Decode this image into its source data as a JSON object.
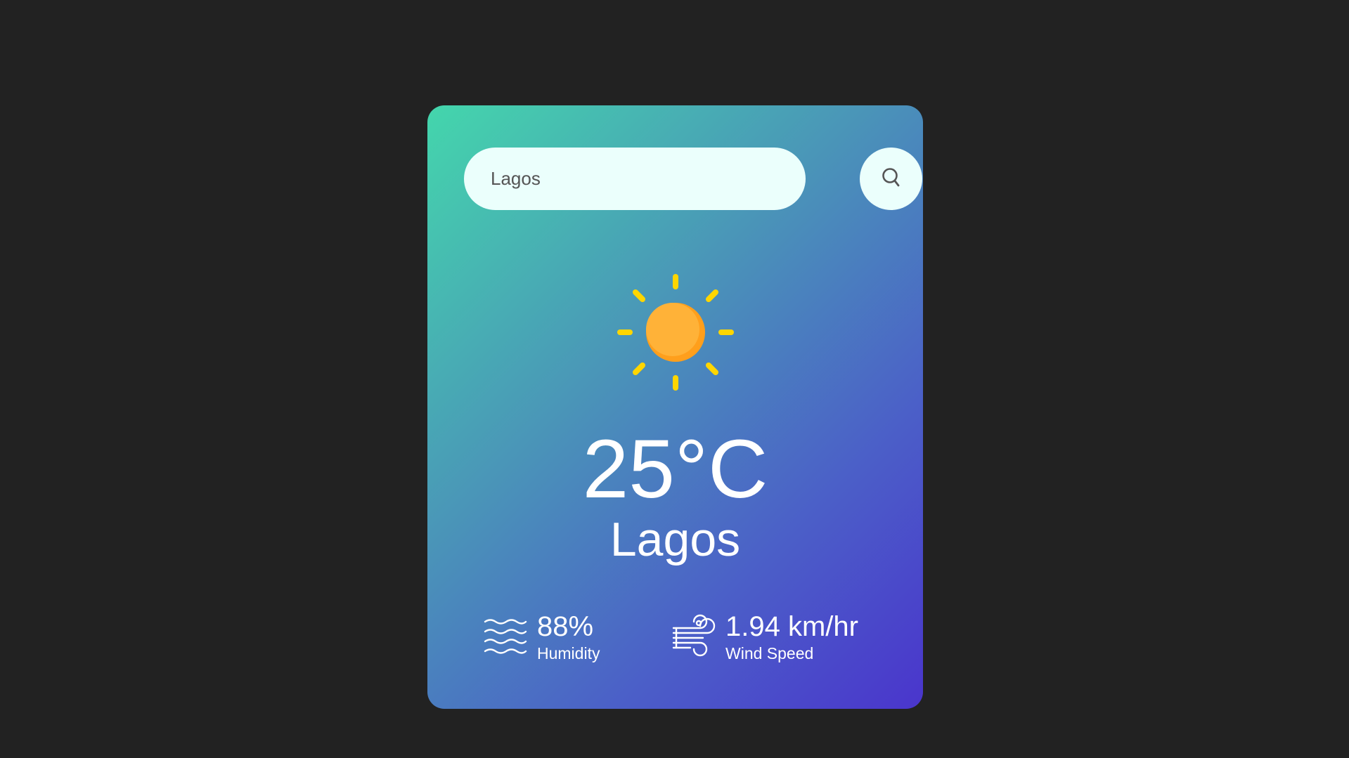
{
  "search": {
    "value": "Lagos",
    "button_icon": "search-icon"
  },
  "weather": {
    "icon": "sun-icon",
    "temperature": "25°C",
    "city": "Lagos"
  },
  "details": {
    "humidity": {
      "icon": "humidity-waves-icon",
      "value": "88%",
      "label": "Humidity"
    },
    "wind": {
      "icon": "wind-icon",
      "value": "1.94 km/hr",
      "label": "Wind Speed"
    }
  },
  "colors": {
    "background": "#222222",
    "card_gradient_start": "#44d6ac",
    "card_gradient_end": "#4a35cc",
    "input_background": "#ebfffc",
    "sun_body": "#ffb238",
    "sun_rays": "#ffd600"
  }
}
